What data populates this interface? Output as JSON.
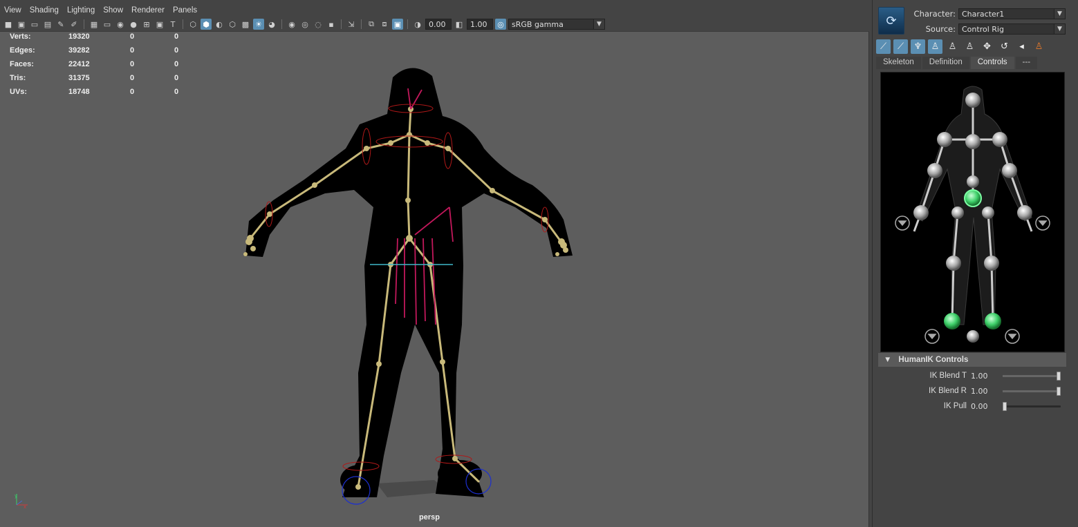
{
  "viewport": {
    "menu": [
      "View",
      "Shading",
      "Lighting",
      "Show",
      "Renderer",
      "Panels"
    ],
    "toolbar": {
      "exposure_value": "0.00",
      "gamma_value": "1.00",
      "color_space": "sRGB gamma"
    },
    "hud": {
      "rows": [
        {
          "label": "Verts:",
          "v1": "19320",
          "v2": "0",
          "v3": "0"
        },
        {
          "label": "Edges:",
          "v1": "39282",
          "v2": "0",
          "v3": "0"
        },
        {
          "label": "Faces:",
          "v1": "22412",
          "v2": "0",
          "v3": "0"
        },
        {
          "label": "Tris:",
          "v1": "31375",
          "v2": "0",
          "v3": "0"
        },
        {
          "label": "UVs:",
          "v1": "18748",
          "v2": "0",
          "v3": "0"
        }
      ]
    },
    "camera_label": "persp"
  },
  "hik": {
    "character_label": "Character:",
    "character_value": "Character1",
    "source_label": "Source:",
    "source_value": "Control Rig",
    "tabs": [
      "Skeleton",
      "Definition",
      "Controls",
      "---"
    ],
    "active_tab": "Controls",
    "section_title": "HumanIK Controls",
    "controls": [
      {
        "label": "IK Blend T",
        "value": "1.00",
        "level": 1.0
      },
      {
        "label": "IK Blend R",
        "value": "1.00",
        "level": 1.0
      },
      {
        "label": "IK Pull",
        "value": "0.00",
        "level": 0.0
      }
    ]
  },
  "colors": {
    "viewport_bg": "#5d5d5d",
    "bone": "#c8b97a",
    "ik_control": "#c2185b",
    "selection_blue": "#5b8fb3",
    "active_effector": "#3fd06a"
  }
}
